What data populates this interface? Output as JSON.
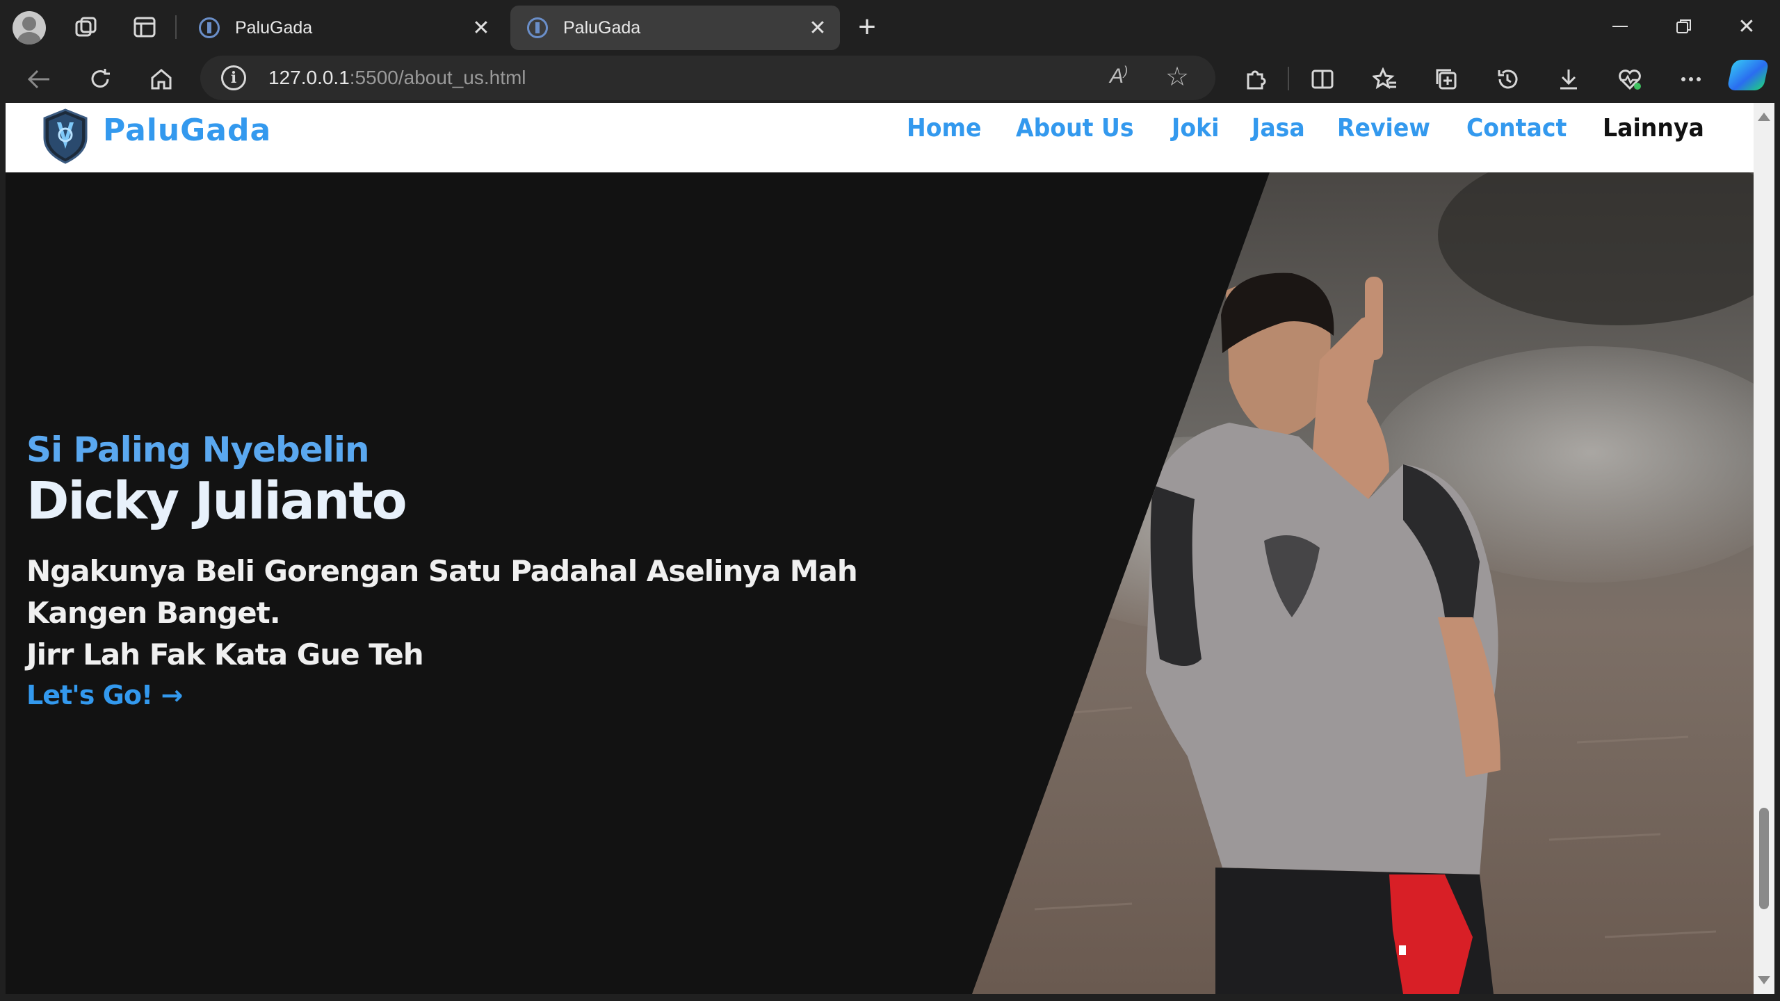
{
  "browser": {
    "tabs": [
      {
        "title": "PaluGada",
        "active": false
      },
      {
        "title": "PaluGada",
        "active": true
      }
    ],
    "address": {
      "host": "127.0.0.1",
      "rest": ":5500/about_us.html"
    },
    "icons": {
      "back": "back-arrow-icon",
      "refresh": "refresh-icon",
      "home": "home-icon",
      "read_aloud": "read-aloud-icon",
      "favorite": "star-icon",
      "extensions": "extensions-icon",
      "split": "split-screen-icon",
      "favorites": "favorites-icon",
      "collections": "collections-icon",
      "history": "history-icon",
      "downloads": "download-icon",
      "health": "browser-essentials-icon",
      "more": "more-icon",
      "copilot": "copilot-icon"
    }
  },
  "site": {
    "brand": "PaluGada",
    "colors": {
      "accent": "#3399ee",
      "background": "#121212"
    },
    "nav": [
      {
        "label": "Home"
      },
      {
        "label": "About Us"
      },
      {
        "label": "Joki"
      },
      {
        "label": "Jasa"
      },
      {
        "label": "Review"
      },
      {
        "label": "Contact"
      },
      {
        "label": "Lainnya"
      }
    ]
  },
  "hero": {
    "subtitle": "Si Paling Nyebelin",
    "title": "Dicky Julianto",
    "line1": "Ngakunya Beli Gorengan Satu Padahal Aselinya Mah",
    "line2": "Kangen Banget.",
    "line3": "Jirr Lah Fak Kata Gue Teh",
    "cta": "Let's Go! →"
  }
}
